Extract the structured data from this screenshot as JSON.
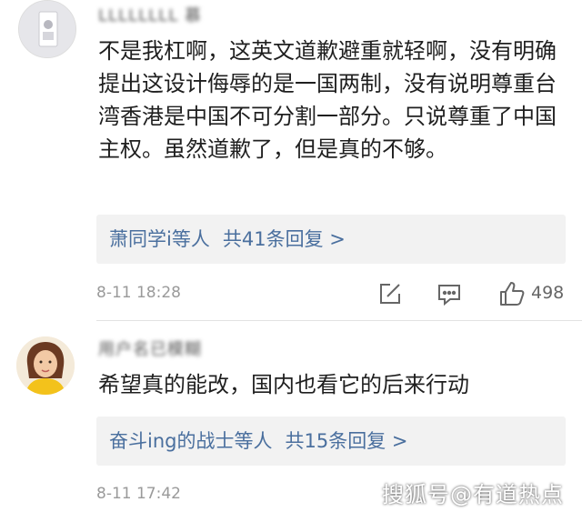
{
  "comments": [
    {
      "username": "LLLLLLLL 慕",
      "text": "不是我杠啊，这英文道歉避重就轻啊，没有明确提出这设计侮辱的是一国两制，没有说明尊重台湾香港是中国不可分割一部分。只说尊重了中国主权。虽然道歉了，但是真的不够。",
      "replies_users": "萧同学i等人",
      "replies_count": "共41条回复 >",
      "timestamp": "8-11 18:28",
      "likes": "498"
    },
    {
      "username": "用户名已模糊",
      "text": "希望真的能改，国内也看它的后来行动",
      "replies_users": "奋斗ing的战士等人",
      "replies_count": "共15条回复 >",
      "timestamp": "8-11 17:42"
    }
  ],
  "watermark": "搜狐号@有道热点",
  "colors": {
    "link": "#4a6f9e",
    "reply_bg": "#f2f2f2",
    "meta": "#9a9a9a"
  }
}
